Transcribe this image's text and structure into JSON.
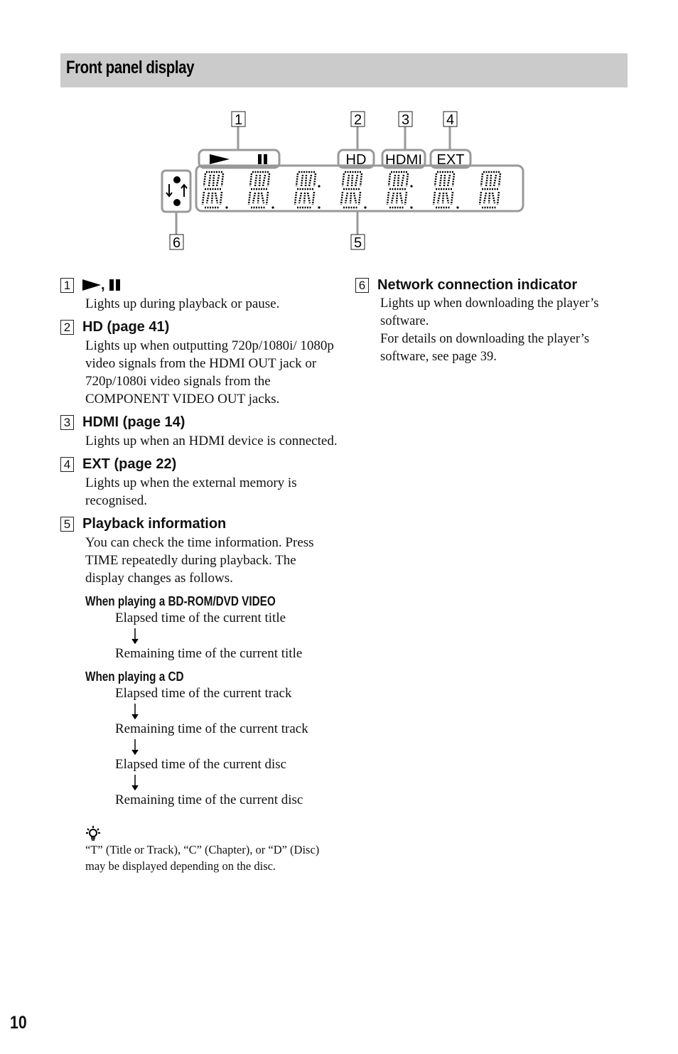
{
  "header": {
    "title": "Front panel display"
  },
  "diagram": {
    "callouts": [
      "1",
      "2",
      "3",
      "4",
      "5",
      "6"
    ],
    "indicators": {
      "hd": "HD",
      "hdmi": "HDMI",
      "ext": "EXT"
    },
    "digit_count": 7,
    "icons": [
      "play-icon",
      "pause-icon",
      "network-icon"
    ]
  },
  "items": [
    {
      "num": "1",
      "title_sep": ",",
      "body": "Lights up during playback or pause."
    },
    {
      "num": "2",
      "title": "HD (page 41)",
      "body": "Lights up when outputting 720p/1080i/ 1080p video signals from the HDMI OUT jack or 720p/1080i video signals from the COMPONENT VIDEO OUT jacks."
    },
    {
      "num": "3",
      "title": "HDMI (page 14)",
      "body": "Lights up when an HDMI device is connected."
    },
    {
      "num": "4",
      "title": "EXT (page 22)",
      "body": "Lights up when the external memory is recognised."
    },
    {
      "num": "5",
      "title": "Playback information",
      "body": "You can check the time information. Press TIME repeatedly during playback. The display changes as follows."
    },
    {
      "num": "6",
      "title": "Network connection indicator",
      "body1": "Lights up when downloading the player’s software.",
      "body2": "For details on downloading the player’s software, see page 39."
    }
  ],
  "playback": {
    "bd": {
      "heading": "When playing a BD-ROM/DVD VIDEO",
      "steps": [
        "Elapsed time of the current title",
        "Remaining time of the current title"
      ]
    },
    "cd": {
      "heading": "When playing a CD",
      "steps": [
        "Elapsed time of the current track",
        "Remaining time of the current track",
        "Elapsed time of the current disc",
        "Remaining time of the current disc"
      ]
    }
  },
  "tip": {
    "icon": "lightbulb-hint-icon",
    "text": "“T” (Title or Track), “C” (Chapter), or “D” (Disc) may be displayed depending on the disc."
  },
  "page_number": "10"
}
